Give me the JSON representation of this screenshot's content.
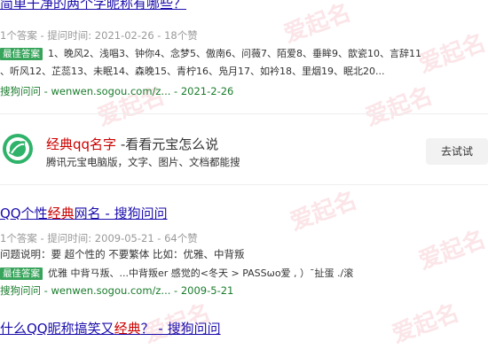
{
  "result1": {
    "title_plain": "简单干净的两个字昵称有哪些？",
    "meta": "1个答案 - 提问时间: 2021-02-26 - 18个赞",
    "badge": "最佳答案",
    "answer_line1": "1、晚风2、浅唱3、钟你4、念梦5、傲南6、问薇7、陌爱8、垂眸9、歆瓷10、言辞11",
    "answer_line2": "、听风12、芷蕊13、未眠14、森晚15、青柠16、凫月17、如衿18、里烟19、眠北20...",
    "source_brand": "搜狗问问",
    "source_url": " - wenwen.sogou.com/z... - 2021-2-26"
  },
  "ad": {
    "title_brand": "经典qq名字",
    "title_rest": " -看看元宝怎么说",
    "desc": "腾讯元宝电脑版，文字、图片、文档都能搜",
    "button": "去试试"
  },
  "result2": {
    "title_a": "QQ个性",
    "title_hl": "经典",
    "title_b": "网名 - 搜狗问问",
    "meta": "1个答案 - 提问时间: 2009-05-21 - 64个赞",
    "question_label": "问题说明：",
    "question_text": "要 超个性的 不要繁体 比如：优雅、中背叛",
    "badge": "最佳答案",
    "answer": "优雅 中背ㄢ叛、...中背叛er 感觉的<冬天 > PASSωο爱 , ）ˉ扯蛋 ./滚",
    "source_brand": "搜狗问问",
    "source_url": " - wenwen.sogou.com/z... - 2009-5-21"
  },
  "result3": {
    "title_a": "什么QQ昵称搞笑又",
    "title_hl": "经典",
    "title_b": "？ - 搜狗问问"
  },
  "watermark": "爱起名",
  "colors": {
    "link": "#1a0dab",
    "highlight": "#cc0000",
    "badge": "#38a45b",
    "source": "#1a7c2c"
  }
}
